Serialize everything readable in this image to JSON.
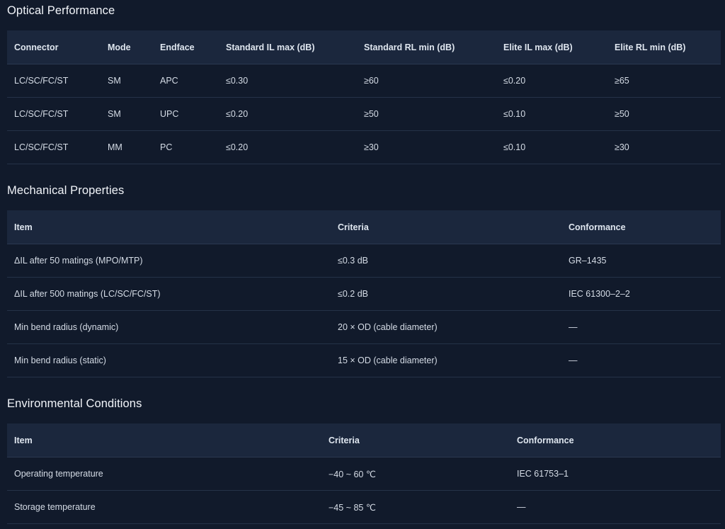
{
  "optical": {
    "title": "Optical Performance",
    "headers": [
      "Connector",
      "Mode",
      "Endface",
      "Standard IL max (dB)",
      "Standard RL min (dB)",
      "Elite IL max (dB)",
      "Elite RL min (dB)"
    ],
    "rows": [
      [
        "LC/SC/FC/ST",
        "SM",
        "APC",
        "≤0.30",
        "≥60",
        "≤0.20",
        "≥65"
      ],
      [
        "LC/SC/FC/ST",
        "SM",
        "UPC",
        "≤0.20",
        "≥50",
        "≤0.10",
        "≥50"
      ],
      [
        "LC/SC/FC/ST",
        "MM",
        "PC",
        "≤0.20",
        "≥30",
        "≤0.10",
        "≥30"
      ]
    ]
  },
  "mechanical": {
    "title": "Mechanical Properties",
    "headers": [
      "Item",
      "Criteria",
      "Conformance"
    ],
    "rows": [
      [
        "ΔIL after 50 matings (MPO/MTP)",
        "≤0.3 dB",
        "GR–1435"
      ],
      [
        "ΔIL after 500 matings (LC/SC/FC/ST)",
        "≤0.2 dB",
        "IEC 61300–2–2"
      ],
      [
        "Min bend radius (dynamic)",
        "20 × OD (cable diameter)",
        "—"
      ],
      [
        "Min bend radius (static)",
        "15 × OD (cable diameter)",
        "—"
      ]
    ]
  },
  "environmental": {
    "title": "Environmental Conditions",
    "headers": [
      "Item",
      "Criteria",
      "Conformance"
    ],
    "rows": [
      [
        "Operating temperature",
        "−40 ~ 60 ℃",
        "IEC 61753–1"
      ],
      [
        "Storage temperature",
        "−45 ~ 85 ℃",
        "—"
      ]
    ]
  }
}
